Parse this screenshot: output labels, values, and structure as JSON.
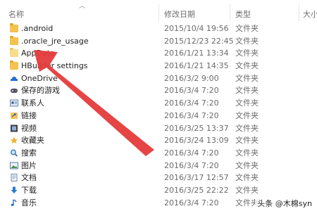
{
  "columns": {
    "name": "名称",
    "date": "修改日期",
    "type": "类型",
    "size": "大小"
  },
  "rows": [
    {
      "name": ".android",
      "date": "2015/10/4 19:56",
      "type": "文件夹",
      "icon": "folder-icon"
    },
    {
      "name": ".oracle_jre_usage",
      "date": "2015/12/23 22:45",
      "type": "文件夹",
      "icon": "folder-icon"
    },
    {
      "name": "AppData",
      "date": "2016/1/21 13:34",
      "type": "文件夹",
      "icon": "folder-light-icon"
    },
    {
      "name": "HBuilder settings",
      "date": "2016/1/21 14:35",
      "type": "文件夹",
      "icon": "folder-icon"
    },
    {
      "name": "OneDrive",
      "date": "2016/3/2 9:00",
      "type": "文件夹",
      "icon": "onedrive-icon"
    },
    {
      "name": "保存的游戏",
      "date": "2016/3/4 7:20",
      "type": "文件夹",
      "icon": "saved-games-icon"
    },
    {
      "name": "联系人",
      "date": "2016/3/4 7:20",
      "type": "文件夹",
      "icon": "contacts-icon"
    },
    {
      "name": "链接",
      "date": "2016/3/4 7:20",
      "type": "文件夹",
      "icon": "links-icon"
    },
    {
      "name": "视频",
      "date": "2016/3/25 13:37",
      "type": "文件夹",
      "icon": "videos-icon"
    },
    {
      "name": "收藏夹",
      "date": "2016/3/24 13:09",
      "type": "文件夹",
      "icon": "favorites-icon"
    },
    {
      "name": "搜索",
      "date": "2016/3/4 7:20",
      "type": "文件夹",
      "icon": "search-icon"
    },
    {
      "name": "图片",
      "date": "2016/3/4 7:20",
      "type": "文件夹",
      "icon": "pictures-icon"
    },
    {
      "name": "文档",
      "date": "2016/3/17 12:57",
      "type": "文件夹",
      "icon": "documents-icon"
    },
    {
      "name": "下载",
      "date": "2016/3/25 22:22",
      "type": "文件夹",
      "icon": "downloads-icon"
    },
    {
      "name": "音乐",
      "date": "2016/3/4 7:20",
      "type": "文件夹",
      "icon": "music-icon"
    }
  ],
  "watermark": "头条 @木棉syn",
  "colors": {
    "annotation_arrow": "#e53b3b",
    "folder": "#f3c24f"
  }
}
